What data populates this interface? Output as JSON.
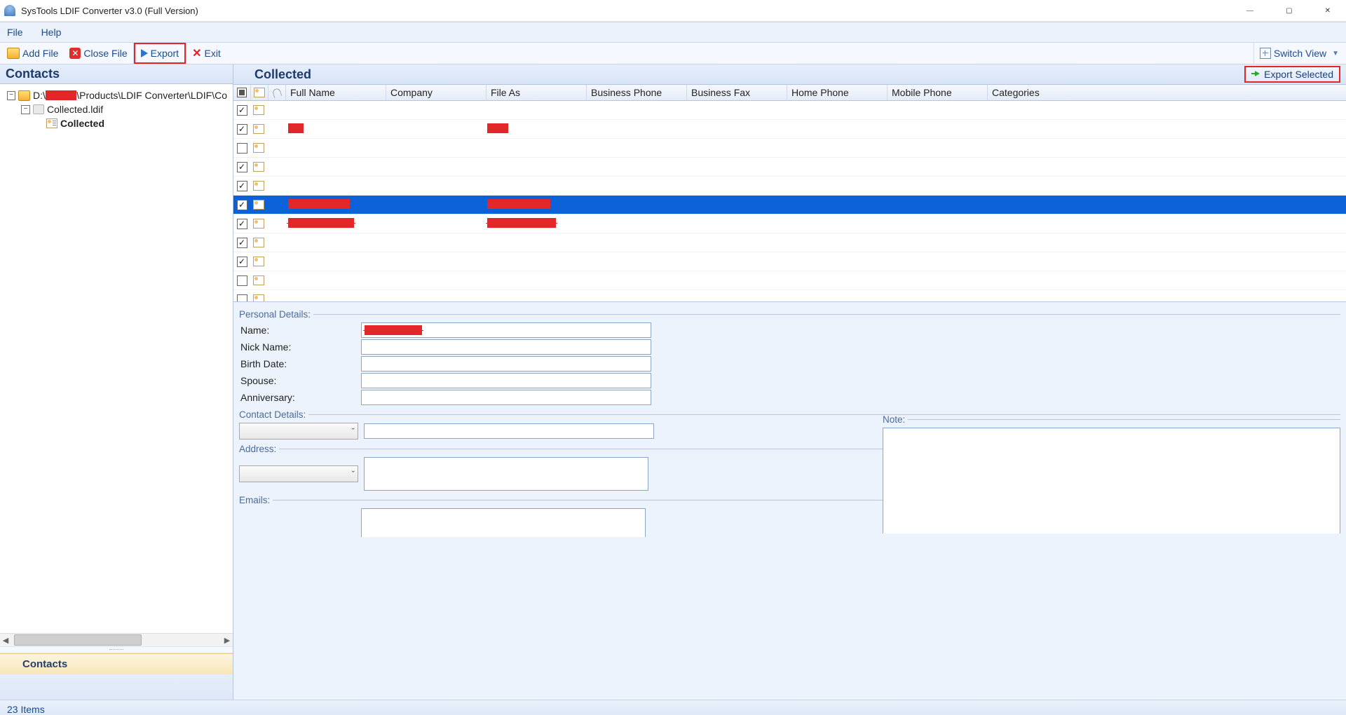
{
  "title": "SysTools LDIF Converter v3.0 (Full Version)",
  "menu": {
    "file": "File",
    "help": "Help"
  },
  "toolbar": {
    "add_file": "Add File",
    "close_file": "Close File",
    "export": "Export",
    "exit": "Exit",
    "switch_view": "Switch View"
  },
  "left": {
    "header": "Contacts",
    "tree": {
      "root_prefix": "D:\\",
      "root_suffix": "\\Products\\LDIF Converter\\LDIF\\Co",
      "file": "Collected.ldif",
      "item": "Collected"
    },
    "footer": "Contacts"
  },
  "right": {
    "header": "Collected",
    "export_selected": "Export Selected",
    "columns": {
      "full_name": "Full Name",
      "company": "Company",
      "file_as": "File As",
      "business_phone": "Business Phone",
      "business_fax": "Business Fax",
      "home_phone": "Home Phone",
      "mobile_phone": "Mobile Phone",
      "categories": "Categories"
    },
    "rows": [
      {
        "checked": true,
        "redacted": false,
        "selected": false
      },
      {
        "checked": true,
        "redacted": true,
        "selected": false,
        "full_w": 22,
        "file_w": 30
      },
      {
        "checked": false,
        "redacted": false,
        "selected": false
      },
      {
        "checked": true,
        "redacted": false,
        "selected": false
      },
      {
        "checked": true,
        "redacted": false,
        "selected": false
      },
      {
        "checked": true,
        "redacted": true,
        "selected": true,
        "full_w": 88,
        "file_w": 90
      },
      {
        "checked": true,
        "redacted": true,
        "selected": false,
        "full_w": 94,
        "file_w": 98
      },
      {
        "checked": true,
        "redacted": false,
        "selected": false
      },
      {
        "checked": true,
        "redacted": false,
        "selected": false
      },
      {
        "checked": false,
        "redacted": false,
        "selected": false
      },
      {
        "checked": false,
        "redacted": false,
        "selected": false
      }
    ]
  },
  "details": {
    "personal_legend": "Personal Details:",
    "name": "Name:",
    "nick": "Nick Name:",
    "birth": "Birth Date:",
    "spouse": "Spouse:",
    "anniv": "Anniversary:",
    "contact_legend": "Contact Details:",
    "address_legend": "Address:",
    "emails_legend": "Emails:",
    "note_legend": "Note:",
    "name_value_redacted_w": 82
  },
  "status": "23 Items"
}
